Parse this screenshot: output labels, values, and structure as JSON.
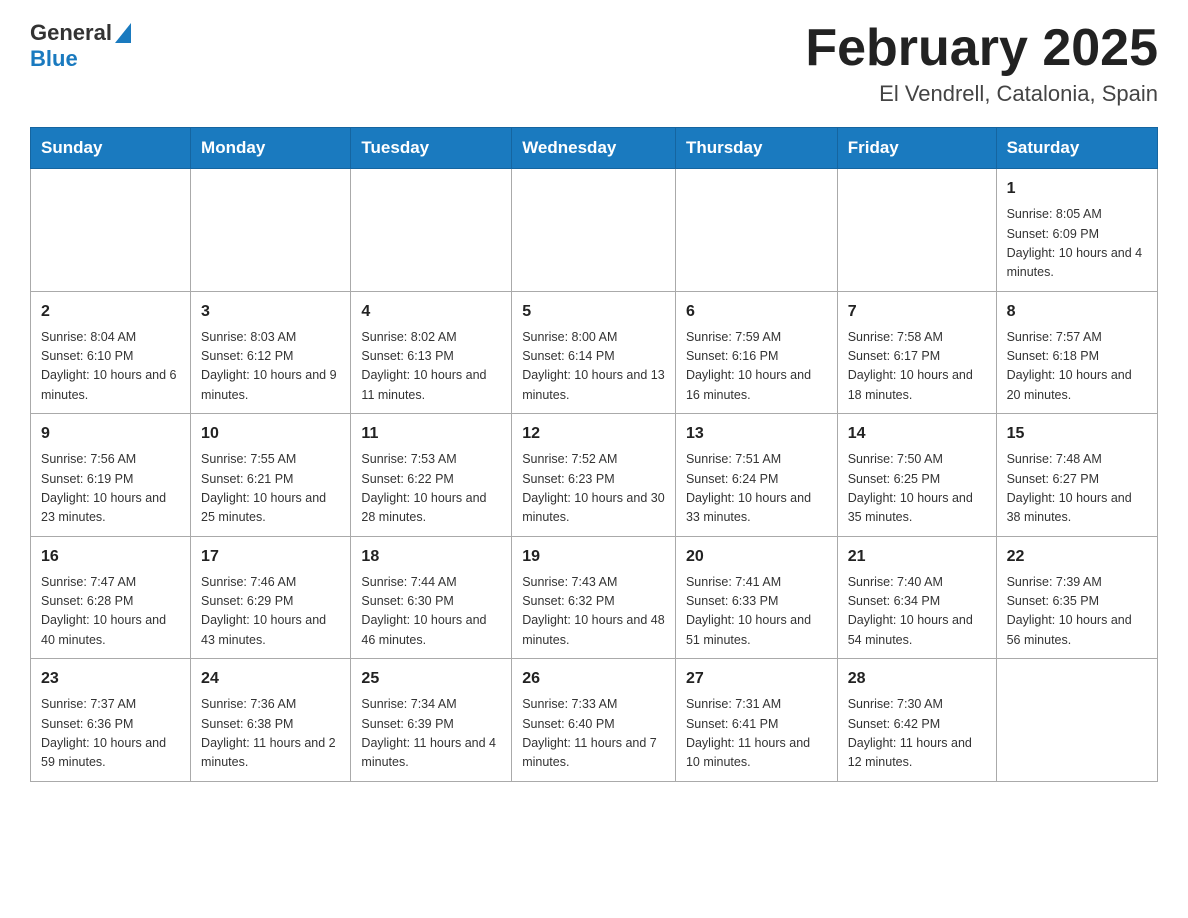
{
  "header": {
    "logo_general": "General",
    "logo_blue": "Blue",
    "month_title": "February 2025",
    "location": "El Vendrell, Catalonia, Spain"
  },
  "weekdays": [
    "Sunday",
    "Monday",
    "Tuesday",
    "Wednesday",
    "Thursday",
    "Friday",
    "Saturday"
  ],
  "weeks": [
    [
      {
        "day": "",
        "info": ""
      },
      {
        "day": "",
        "info": ""
      },
      {
        "day": "",
        "info": ""
      },
      {
        "day": "",
        "info": ""
      },
      {
        "day": "",
        "info": ""
      },
      {
        "day": "",
        "info": ""
      },
      {
        "day": "1",
        "info": "Sunrise: 8:05 AM\nSunset: 6:09 PM\nDaylight: 10 hours and 4 minutes."
      }
    ],
    [
      {
        "day": "2",
        "info": "Sunrise: 8:04 AM\nSunset: 6:10 PM\nDaylight: 10 hours and 6 minutes."
      },
      {
        "day": "3",
        "info": "Sunrise: 8:03 AM\nSunset: 6:12 PM\nDaylight: 10 hours and 9 minutes."
      },
      {
        "day": "4",
        "info": "Sunrise: 8:02 AM\nSunset: 6:13 PM\nDaylight: 10 hours and 11 minutes."
      },
      {
        "day": "5",
        "info": "Sunrise: 8:00 AM\nSunset: 6:14 PM\nDaylight: 10 hours and 13 minutes."
      },
      {
        "day": "6",
        "info": "Sunrise: 7:59 AM\nSunset: 6:16 PM\nDaylight: 10 hours and 16 minutes."
      },
      {
        "day": "7",
        "info": "Sunrise: 7:58 AM\nSunset: 6:17 PM\nDaylight: 10 hours and 18 minutes."
      },
      {
        "day": "8",
        "info": "Sunrise: 7:57 AM\nSunset: 6:18 PM\nDaylight: 10 hours and 20 minutes."
      }
    ],
    [
      {
        "day": "9",
        "info": "Sunrise: 7:56 AM\nSunset: 6:19 PM\nDaylight: 10 hours and 23 minutes."
      },
      {
        "day": "10",
        "info": "Sunrise: 7:55 AM\nSunset: 6:21 PM\nDaylight: 10 hours and 25 minutes."
      },
      {
        "day": "11",
        "info": "Sunrise: 7:53 AM\nSunset: 6:22 PM\nDaylight: 10 hours and 28 minutes."
      },
      {
        "day": "12",
        "info": "Sunrise: 7:52 AM\nSunset: 6:23 PM\nDaylight: 10 hours and 30 minutes."
      },
      {
        "day": "13",
        "info": "Sunrise: 7:51 AM\nSunset: 6:24 PM\nDaylight: 10 hours and 33 minutes."
      },
      {
        "day": "14",
        "info": "Sunrise: 7:50 AM\nSunset: 6:25 PM\nDaylight: 10 hours and 35 minutes."
      },
      {
        "day": "15",
        "info": "Sunrise: 7:48 AM\nSunset: 6:27 PM\nDaylight: 10 hours and 38 minutes."
      }
    ],
    [
      {
        "day": "16",
        "info": "Sunrise: 7:47 AM\nSunset: 6:28 PM\nDaylight: 10 hours and 40 minutes."
      },
      {
        "day": "17",
        "info": "Sunrise: 7:46 AM\nSunset: 6:29 PM\nDaylight: 10 hours and 43 minutes."
      },
      {
        "day": "18",
        "info": "Sunrise: 7:44 AM\nSunset: 6:30 PM\nDaylight: 10 hours and 46 minutes."
      },
      {
        "day": "19",
        "info": "Sunrise: 7:43 AM\nSunset: 6:32 PM\nDaylight: 10 hours and 48 minutes."
      },
      {
        "day": "20",
        "info": "Sunrise: 7:41 AM\nSunset: 6:33 PM\nDaylight: 10 hours and 51 minutes."
      },
      {
        "day": "21",
        "info": "Sunrise: 7:40 AM\nSunset: 6:34 PM\nDaylight: 10 hours and 54 minutes."
      },
      {
        "day": "22",
        "info": "Sunrise: 7:39 AM\nSunset: 6:35 PM\nDaylight: 10 hours and 56 minutes."
      }
    ],
    [
      {
        "day": "23",
        "info": "Sunrise: 7:37 AM\nSunset: 6:36 PM\nDaylight: 10 hours and 59 minutes."
      },
      {
        "day": "24",
        "info": "Sunrise: 7:36 AM\nSunset: 6:38 PM\nDaylight: 11 hours and 2 minutes."
      },
      {
        "day": "25",
        "info": "Sunrise: 7:34 AM\nSunset: 6:39 PM\nDaylight: 11 hours and 4 minutes."
      },
      {
        "day": "26",
        "info": "Sunrise: 7:33 AM\nSunset: 6:40 PM\nDaylight: 11 hours and 7 minutes."
      },
      {
        "day": "27",
        "info": "Sunrise: 7:31 AM\nSunset: 6:41 PM\nDaylight: 11 hours and 10 minutes."
      },
      {
        "day": "28",
        "info": "Sunrise: 7:30 AM\nSunset: 6:42 PM\nDaylight: 11 hours and 12 minutes."
      },
      {
        "day": "",
        "info": ""
      }
    ]
  ]
}
